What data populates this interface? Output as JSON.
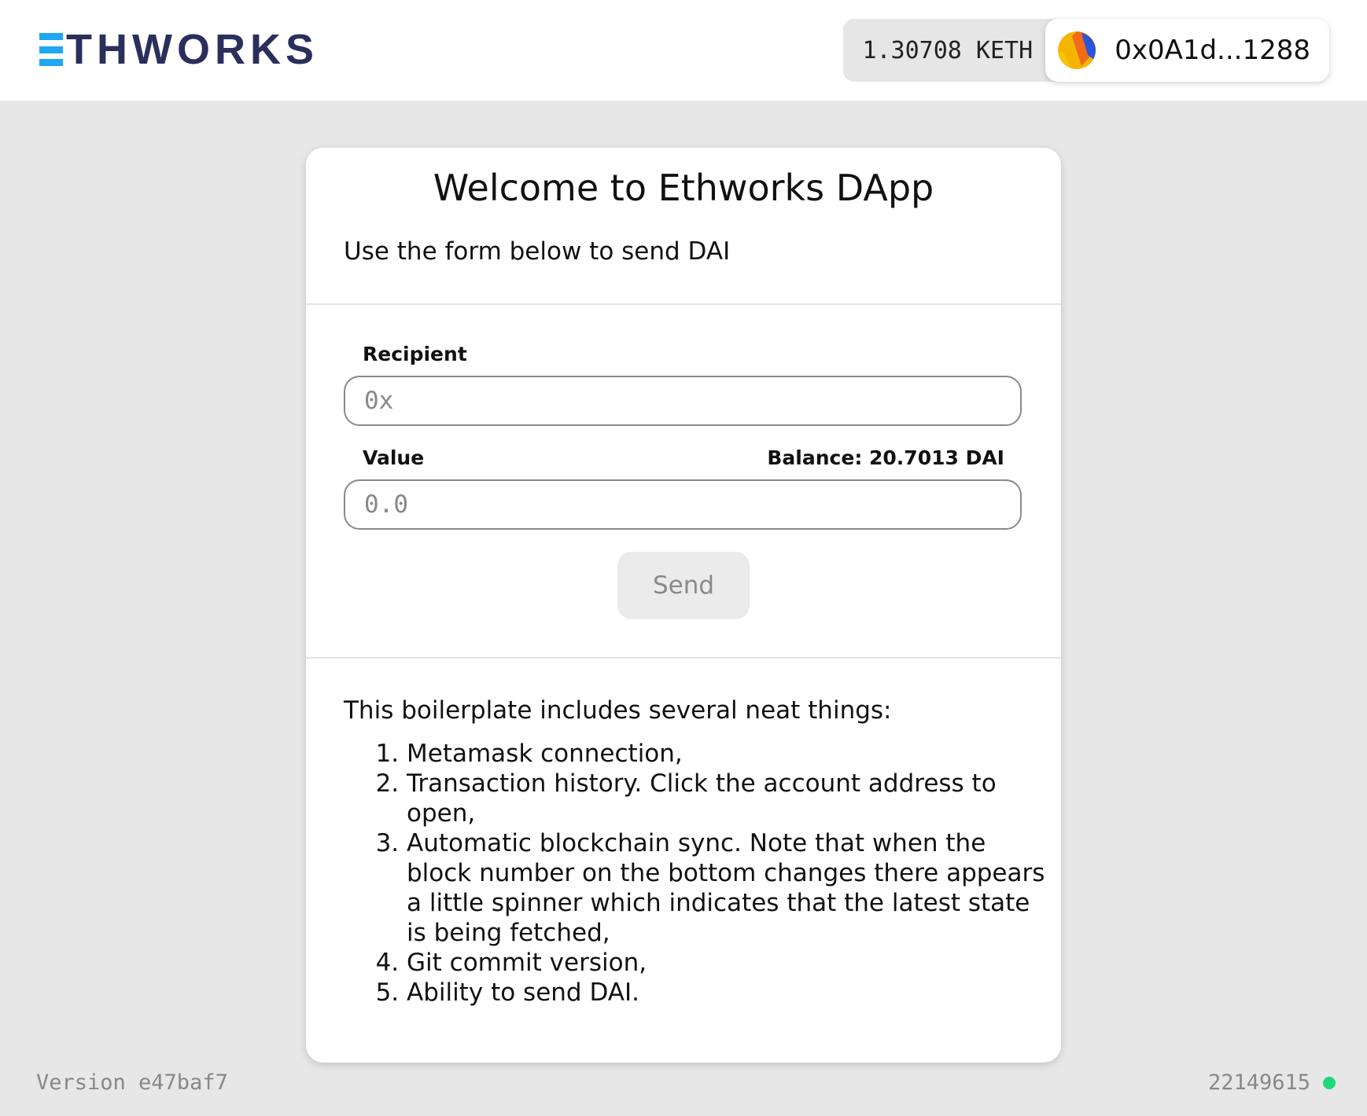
{
  "header": {
    "logo_text": "THWORKS",
    "balance": "1.30708 KETH",
    "address": "0x0A1d...1288"
  },
  "card": {
    "title": "Welcome to Ethworks DApp",
    "subtitle": "Use the form below to send DAI",
    "form": {
      "recipient_label": "Recipient",
      "recipient_placeholder": "0x",
      "value_label": "Value",
      "balance_text": "Balance: 20.7013 DAI",
      "value_placeholder": "0.0",
      "send_label": "Send"
    },
    "info": {
      "intro": "This boilerplate includes several neat things:",
      "items": [
        "Metamask connection,",
        "Transaction history. Click the account address to open,",
        "Automatic blockchain sync. Note that when the block number on the bottom changes there appears a little spinner which indicates that the latest state is being fetched,",
        "Git commit version,",
        "Ability to send DAI."
      ]
    }
  },
  "footer": {
    "version": "Version e47baf7",
    "block_number": "22149615",
    "status_color": "#1ed97a"
  },
  "colors": {
    "logo_accent": "#1ea7f2",
    "logo_text": "#2b2f5c",
    "page_background": "#e7e7e7"
  }
}
